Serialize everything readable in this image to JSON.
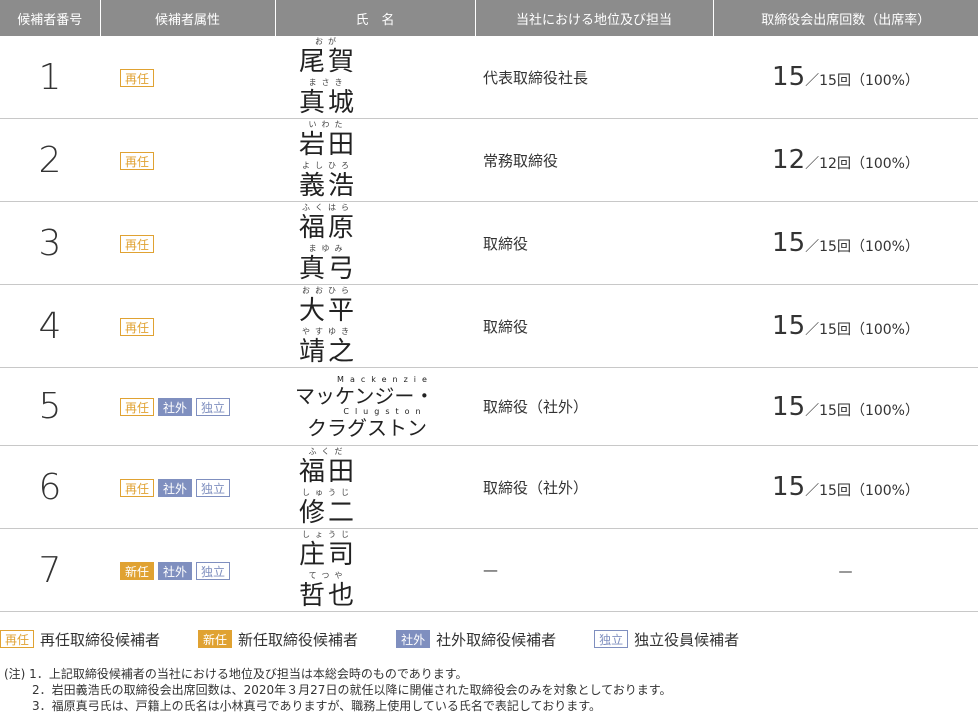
{
  "headers": [
    "候補者番号",
    "候補者属性",
    "氏　名",
    "当社における地位及び担当",
    "取締役会出席回数（出席率）"
  ],
  "badges": {
    "re": "再任",
    "new": "新任",
    "out": "社外",
    "ind": "独立"
  },
  "rows": [
    {
      "num": "1",
      "ruby1": "おが",
      "kanji1": "尾賀",
      "ruby2": "まさき",
      "kanji2": "真城",
      "position": "代表取締役社長",
      "att_big": "15",
      "att_small": "／15回（100%）"
    },
    {
      "num": "2",
      "ruby1": "いわた",
      "kanji1": "岩田",
      "ruby2": "よしひろ",
      "kanji2": "義浩",
      "position": "常務取締役",
      "att_big": "12",
      "att_small": "／12回（100%）"
    },
    {
      "num": "3",
      "ruby1": "ふくはら",
      "kanji1": "福原",
      "ruby2": "まゆみ",
      "kanji2": "真弓",
      "position": "取締役",
      "att_big": "15",
      "att_small": "／15回（100%）"
    },
    {
      "num": "4",
      "ruby1": "おおひら",
      "kanji1": "大平",
      "ruby2": "やすゆき",
      "kanji2": "靖之",
      "position": "取締役",
      "att_big": "15",
      "att_small": "／15回（100%）"
    },
    {
      "num": "5",
      "ruby1": "Mackenzie",
      "kanji1": "マッケンジー・",
      "ruby2": "Clugston",
      "kanji2": "クラグストン",
      "position": "取締役（社外）",
      "att_big": "15",
      "att_small": "／15回（100%）"
    },
    {
      "num": "6",
      "ruby1": "ふくだ",
      "kanji1": "福田",
      "ruby2": "しゅうじ",
      "kanji2": "修二",
      "position": "取締役（社外）",
      "att_big": "15",
      "att_small": "／15回（100%）"
    },
    {
      "num": "7",
      "ruby1": "しょうじ",
      "kanji1": "庄司",
      "ruby2": "てつや",
      "kanji2": "哲也",
      "position": "—",
      "att_dash": "—"
    }
  ],
  "legend": [
    "再任取締役候補者",
    "新任取締役候補者",
    "社外取締役候補者",
    "独立役員候補者"
  ],
  "notes": [
    "(注) 1．上記取締役候補者の当社における地位及び担当は本総会時のものであります。",
    "2．岩田義浩氏の取締役会出席回数は、2020年３月27日の就任以降に開催された取締役会のみを対象としております。",
    "3．福原真弓氏は、戸籍上の氏名は小林真弓でありますが、職務上使用している氏名で表記しております。"
  ]
}
